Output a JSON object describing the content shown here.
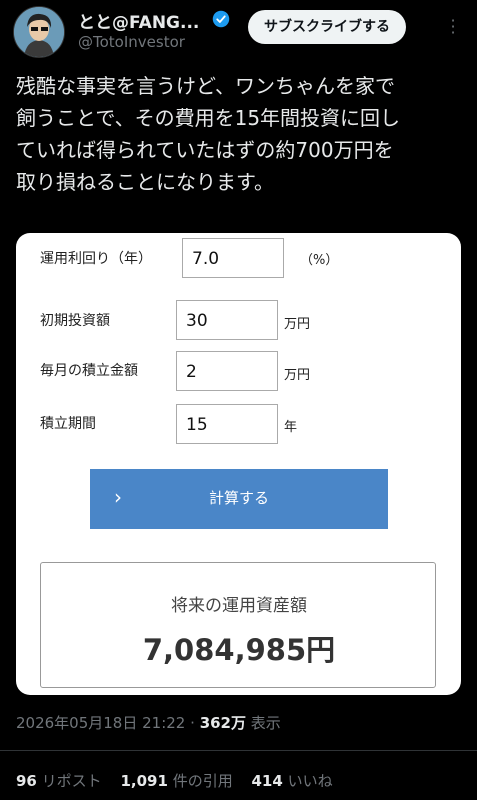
{
  "author": {
    "display_name": "とと@FANG...",
    "handle": "@TotoInvestor",
    "verified": true
  },
  "subscribe_label": "サブスクライブする",
  "tweet": {
    "text": "残酷な事実を言うけど、ワンちゃんを家で\n飼うことで、その費用を15年間投資に回し\nていれば得られていたはずの約700万円を\n取り損ねることになります。"
  },
  "calculator": {
    "rate_label": "運用利回り（年）",
    "rate_value": "7.0",
    "rate_unit": "（%）",
    "initial_label": "初期投資額",
    "initial_value": "30",
    "initial_unit": "万円",
    "monthly_label": "毎月の積立金額",
    "monthly_value": "2",
    "monthly_unit": "万円",
    "period_label": "積立期間",
    "period_value": "15",
    "period_unit": "年",
    "calc_button": "計算する",
    "result_title": "将来の運用資産額",
    "result_value": "7,084,985円"
  },
  "meta": {
    "timestamp": "2026年05月18日 21:22",
    "separator": "·",
    "views_count": "362万",
    "views_label": "表示"
  },
  "stats": {
    "reposts_count": "96",
    "reposts_label": "リポスト",
    "quotes_count": "1,091",
    "quotes_label": "件の引用",
    "likes_count": "414",
    "likes_label": "いいね"
  },
  "colors": {
    "background": "#000000",
    "button_blue": "#4a86c8",
    "verified_blue": "#1d9bf0"
  }
}
